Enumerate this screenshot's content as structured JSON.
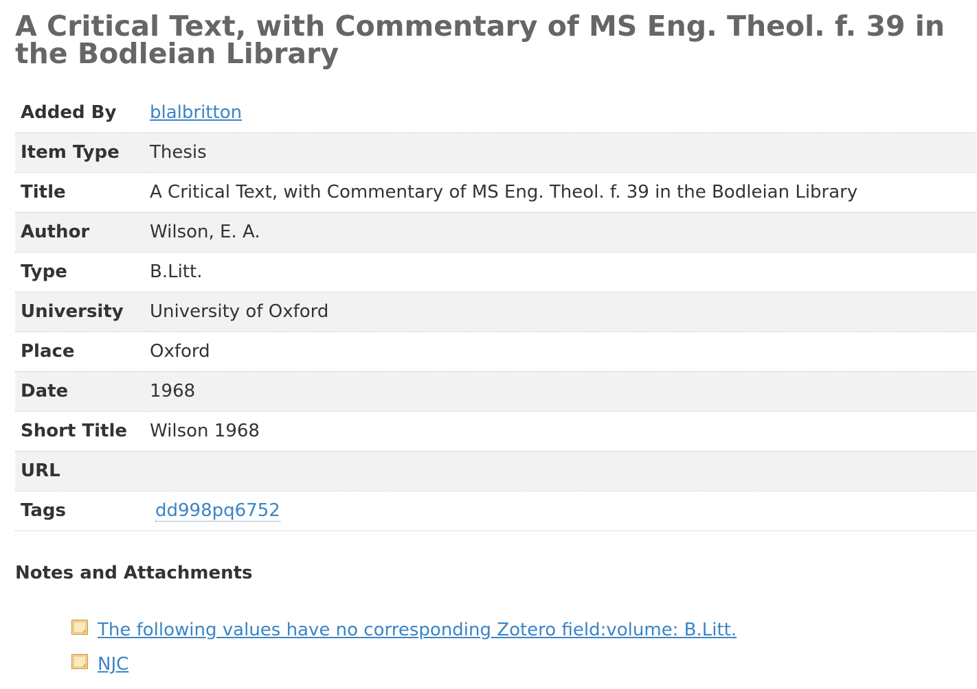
{
  "item": {
    "title": "A Critical Text, with Commentary of MS Eng. Theol. f. 39 in the Bodleian Library"
  },
  "fields": [
    {
      "label": "Added By",
      "value": "blalbritton",
      "kind": "link"
    },
    {
      "label": "Item Type",
      "value": "Thesis",
      "kind": "text"
    },
    {
      "label": "Title",
      "value": "A Critical Text, with Commentary of MS Eng. Theol. f. 39 in the Bodleian Library",
      "kind": "text"
    },
    {
      "label": "Author",
      "value": "Wilson, E. A.",
      "kind": "text"
    },
    {
      "label": "Type",
      "value": "B.Litt.",
      "kind": "text"
    },
    {
      "label": "University",
      "value": "University of Oxford",
      "kind": "text"
    },
    {
      "label": "Place",
      "value": "Oxford",
      "kind": "text"
    },
    {
      "label": "Date",
      "value": "1968",
      "kind": "text"
    },
    {
      "label": "Short Title",
      "value": "Wilson 1968",
      "kind": "text"
    },
    {
      "label": "URL",
      "value": "",
      "kind": "text"
    },
    {
      "label": "Tags",
      "value": "dd998pq6752",
      "kind": "tag"
    }
  ],
  "notes": {
    "heading": "Notes and Attachments",
    "items": [
      {
        "label": "The following values have no corresponding Zotero field:volume: B.Litt.",
        "icon": "note-icon"
      },
      {
        "label": "NJC",
        "icon": "note-icon"
      }
    ]
  },
  "colors": {
    "link": "#3b84c5",
    "title": "#666666",
    "row_alt": "#f2f2f2"
  }
}
